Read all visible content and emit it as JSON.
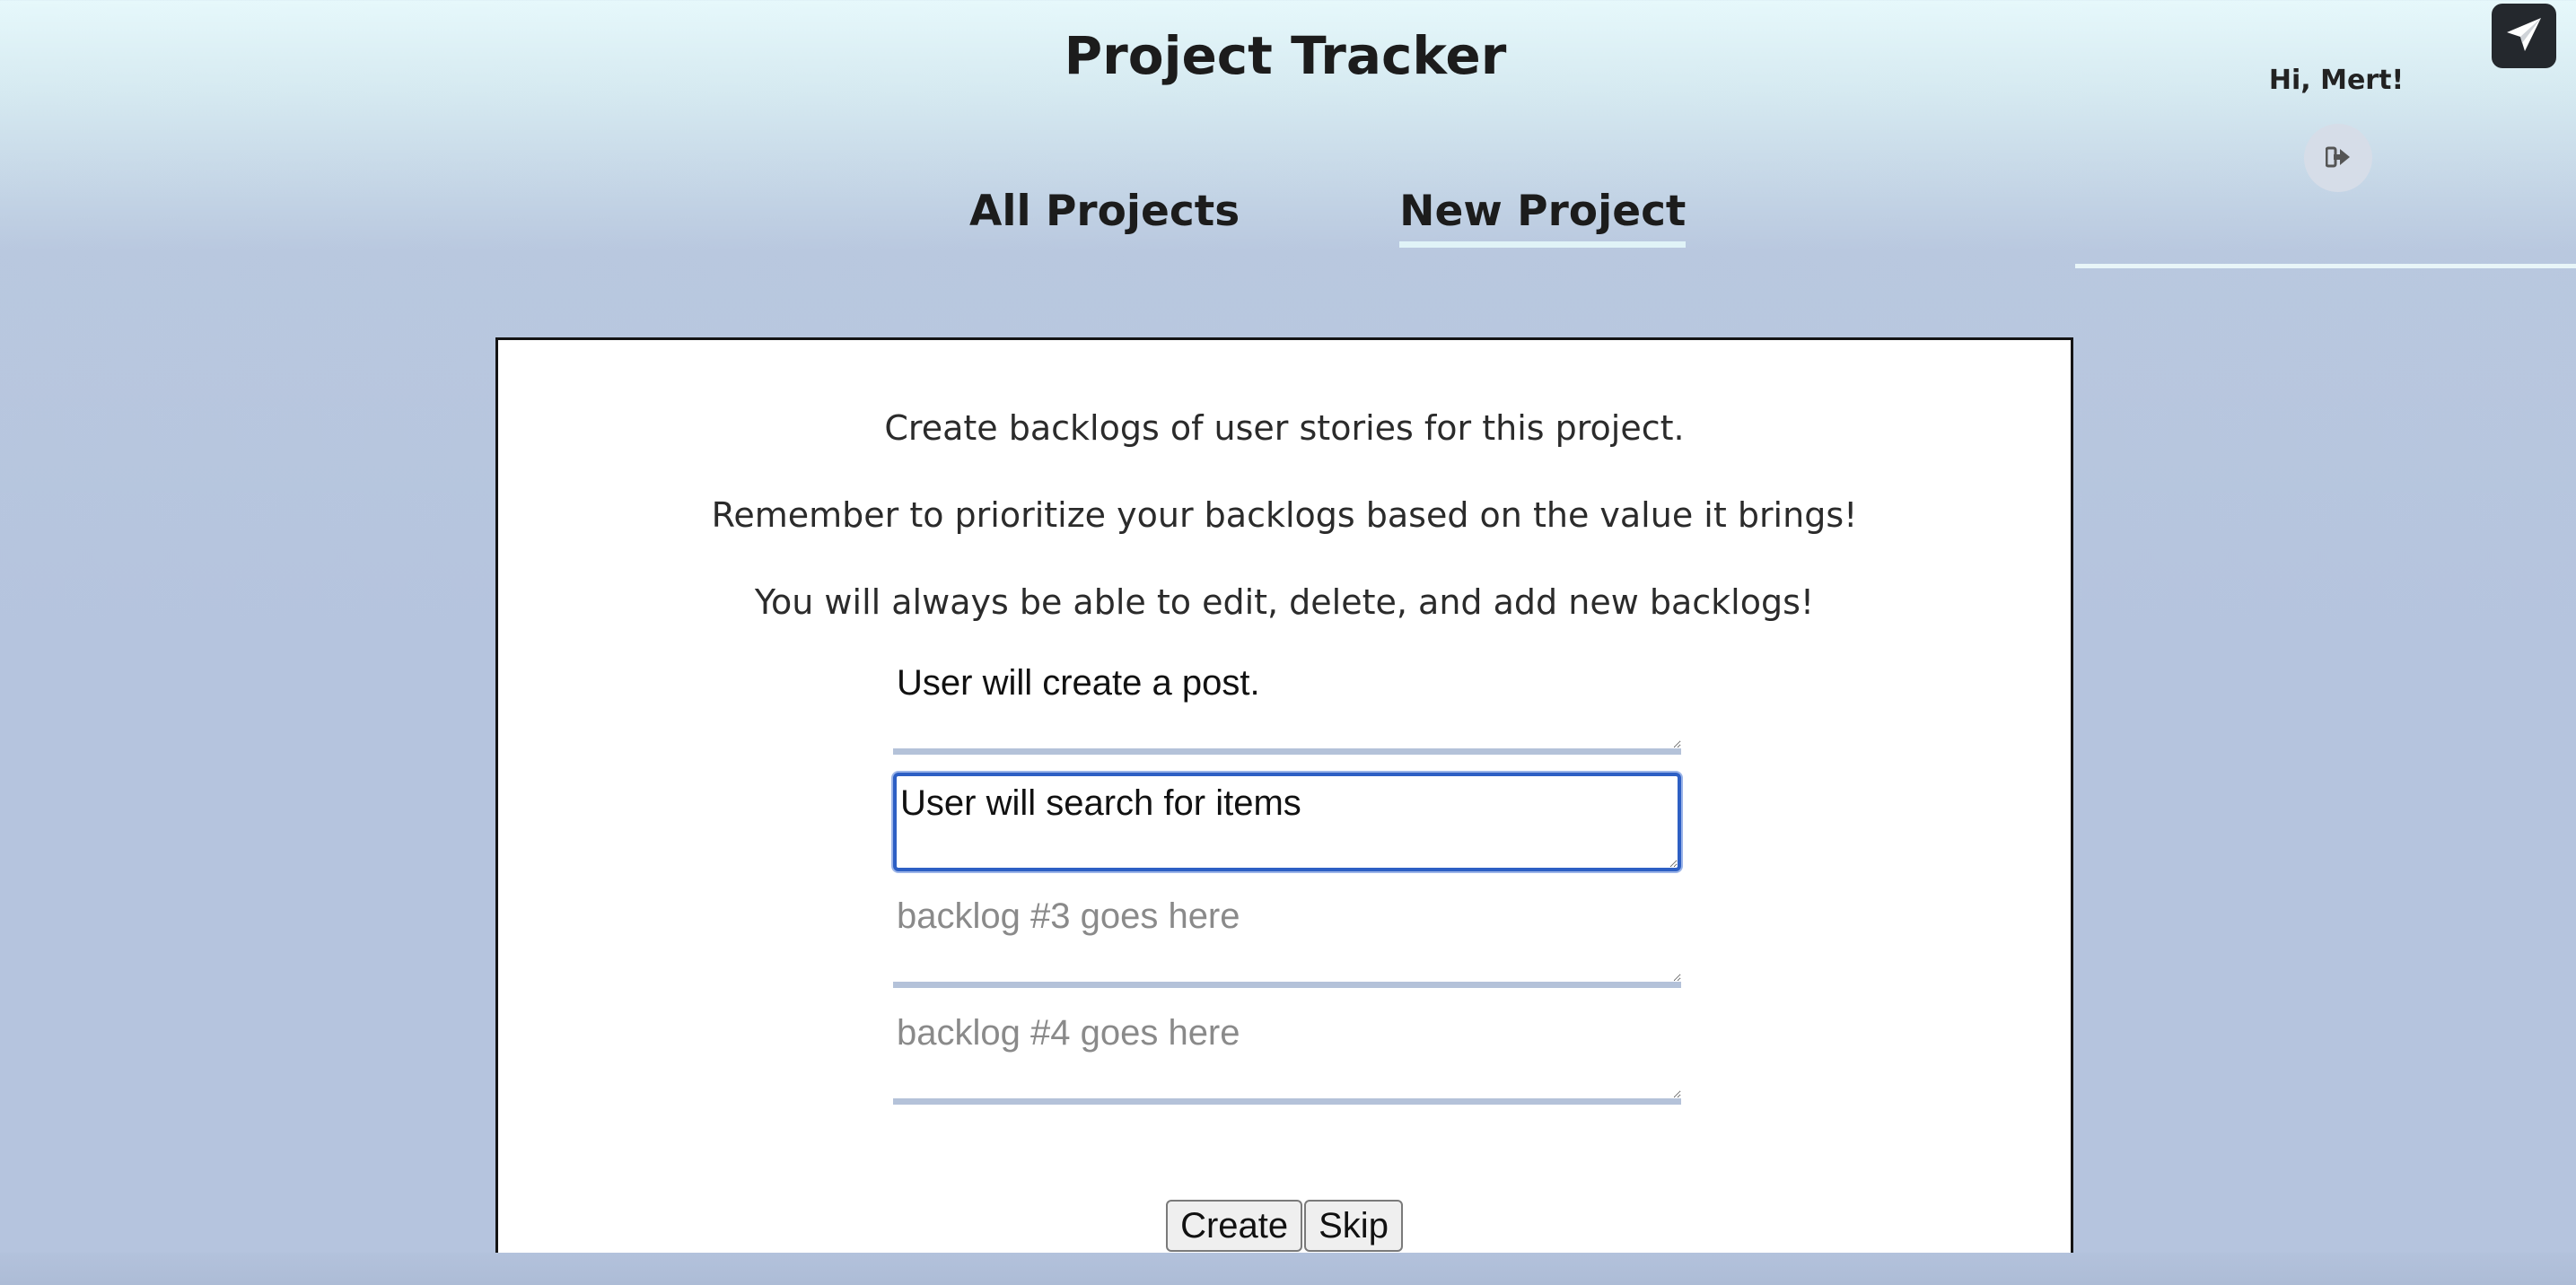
{
  "app": {
    "title": "Project Tracker"
  },
  "nav": {
    "items": [
      {
        "label": "All Projects",
        "active": false
      },
      {
        "label": "New Project",
        "active": true
      }
    ]
  },
  "user": {
    "greeting": "Hi, Mert!",
    "logout_icon": "sign-out-icon"
  },
  "corner_button": {
    "icon": "paper-plane-icon"
  },
  "form": {
    "instructions": [
      "Create backlogs of user stories for this project.",
      "Remember to prioritize your backlogs based on the value it brings!",
      "You will always be able to edit, delete, and add new backlogs!"
    ],
    "backlogs": [
      {
        "value": "User will create a post.",
        "placeholder": ""
      },
      {
        "value": "User will search for items ",
        "placeholder": "",
        "focused": true
      },
      {
        "value": "",
        "placeholder": "backlog #3 goes here"
      },
      {
        "value": "",
        "placeholder": "backlog #4 goes here"
      }
    ],
    "create_label": "Create",
    "skip_label": "Skip"
  },
  "colors": {
    "background": "#b5c4de",
    "header_top": "#e6f8fb",
    "focus_border": "#2d5fc4",
    "field_underline": "#b4c2d9",
    "corner_button": "#24282d"
  }
}
